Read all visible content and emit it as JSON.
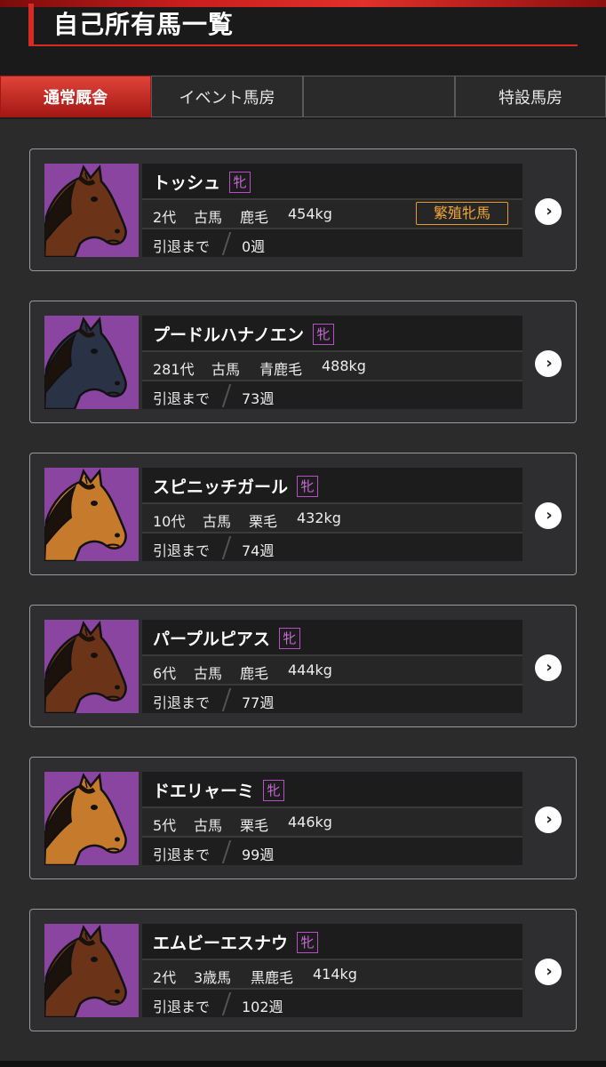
{
  "header": {
    "title": "自己所有馬一覧"
  },
  "tabs": [
    {
      "label": "通常厩舎",
      "active": true
    },
    {
      "label": "イベント馬房",
      "active": false
    },
    {
      "label": "",
      "active": false
    },
    {
      "label": "特設馬房",
      "active": false
    }
  ],
  "labels": {
    "retire": "引退まで",
    "arrow": "›"
  },
  "colors": {
    "accent": "#d72a22",
    "portrait_bg": "#8a45a0",
    "coat_bay": "#6b3418",
    "coat_chestnut": "#c67a2c",
    "coat_blackbay": "#2a3346",
    "breed_badge": "#e79b2a",
    "sex_badge": "#b84fc8"
  },
  "horses": [
    {
      "name": "トッシュ",
      "sex": "牝",
      "generation": "2代",
      "age": "古馬",
      "coat": "鹿毛",
      "weight": "454kg",
      "badge": "繁殖牝馬",
      "retire": "0週",
      "coat_color": "#6b3418"
    },
    {
      "name": "プードルハナノエン",
      "sex": "牝",
      "generation": "281代",
      "age": "古馬",
      "coat": "青鹿毛",
      "weight": "488kg",
      "badge": "",
      "retire": "73週",
      "coat_color": "#2a3346"
    },
    {
      "name": "スピニッチガール",
      "sex": "牝",
      "generation": "10代",
      "age": "古馬",
      "coat": "栗毛",
      "weight": "432kg",
      "badge": "",
      "retire": "74週",
      "coat_color": "#c67a2c"
    },
    {
      "name": "パープルピアス",
      "sex": "牝",
      "generation": "6代",
      "age": "古馬",
      "coat": "鹿毛",
      "weight": "444kg",
      "badge": "",
      "retire": "77週",
      "coat_color": "#6b3418"
    },
    {
      "name": "ドエリャーミ",
      "sex": "牝",
      "generation": "5代",
      "age": "古馬",
      "coat": "栗毛",
      "weight": "446kg",
      "badge": "",
      "retire": "99週",
      "coat_color": "#c67a2c"
    },
    {
      "name": "エムビーエスナウ",
      "sex": "牝",
      "generation": "2代",
      "age": "3歳馬",
      "coat": "黒鹿毛",
      "weight": "414kg",
      "badge": "",
      "retire": "102週",
      "coat_color": "#6b3418"
    }
  ]
}
